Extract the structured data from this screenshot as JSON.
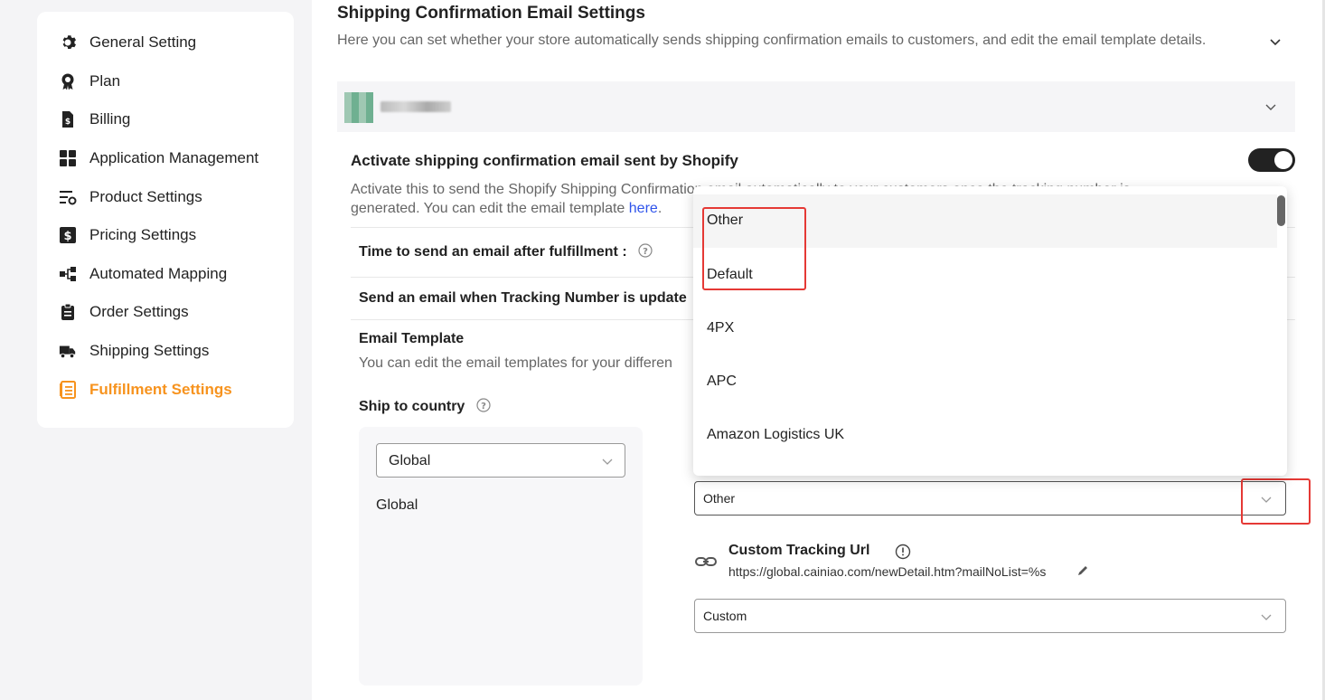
{
  "sidebar": {
    "items": [
      {
        "label": "General Setting",
        "icon": "gear-icon"
      },
      {
        "label": "Plan",
        "icon": "award-icon"
      },
      {
        "label": "Billing",
        "icon": "invoice-icon"
      },
      {
        "label": "Application Management",
        "icon": "grid-icon"
      },
      {
        "label": "Product Settings",
        "icon": "product-settings-icon"
      },
      {
        "label": "Pricing Settings",
        "icon": "dollar-icon"
      },
      {
        "label": "Automated Mapping",
        "icon": "mapping-icon"
      },
      {
        "label": "Order Settings",
        "icon": "clipboard-icon"
      },
      {
        "label": "Shipping Settings",
        "icon": "truck-icon"
      },
      {
        "label": "Fulfillment Settings",
        "icon": "fulfillment-icon",
        "active": true
      }
    ],
    "active_color": "#f7931e"
  },
  "section": {
    "title": "Shipping Confirmation Email Settings",
    "description": "Here you can set whether your store automatically sends shipping confirmation emails to customers, and edit the email template details."
  },
  "activate": {
    "title": "Activate shipping confirmation email sent by Shopify",
    "description_start": "Activate this to send the Shopify Shipping Confirm",
    "description_hidden": "ation email automatically to your customers once the tracking number is",
    "description_line2": "generated. You can edit the email template ",
    "link_text": "here",
    "link_suffix": ".",
    "toggle_on": true
  },
  "rows": {
    "time_label": "Time to send an email after fulfillment :",
    "tracking_label": "Send an email when Tracking Number is update",
    "template_title": "Email Template",
    "template_desc": "You can edit the email templates for your differen",
    "ship_to_country": "Ship to country"
  },
  "country": {
    "select_value": "Global",
    "list_item": "Global"
  },
  "carrier": {
    "selected": "Other",
    "options": [
      "Other",
      "Default",
      "4PX",
      "APC",
      "Amazon Logistics UK"
    ]
  },
  "tracking_url": {
    "title": "Custom Tracking Url",
    "url": "https://global.cainiao.com/newDetail.htm?mailNoList=%s",
    "mode": "Custom"
  },
  "colors": {
    "link": "#2f54eb",
    "highlight": "#e53935",
    "toggle": "#222222"
  }
}
